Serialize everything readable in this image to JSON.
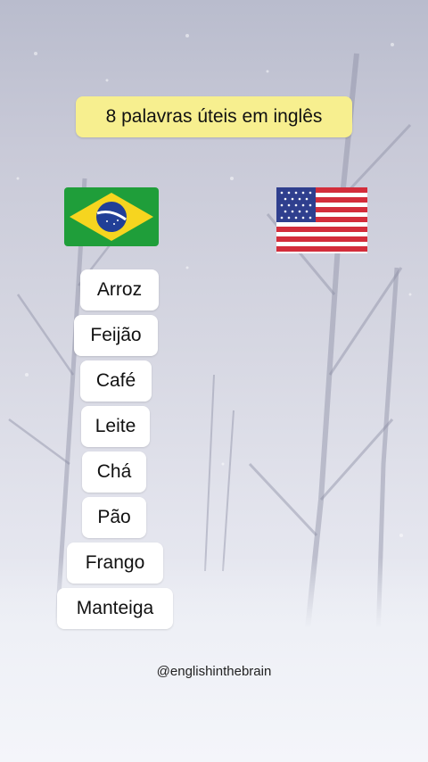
{
  "title": "8 palavras úteis em inglês",
  "flags": {
    "left": "brazil-flag",
    "right": "usa-flag"
  },
  "words": [
    "Arroz",
    "Feijão",
    "Café",
    "Leite",
    "Chá",
    "Pão",
    "Frango",
    "Manteiga"
  ],
  "handle": "@englishinthebrain",
  "colors": {
    "title_bg": "#f7ef8f",
    "word_bg": "#ffffff"
  }
}
